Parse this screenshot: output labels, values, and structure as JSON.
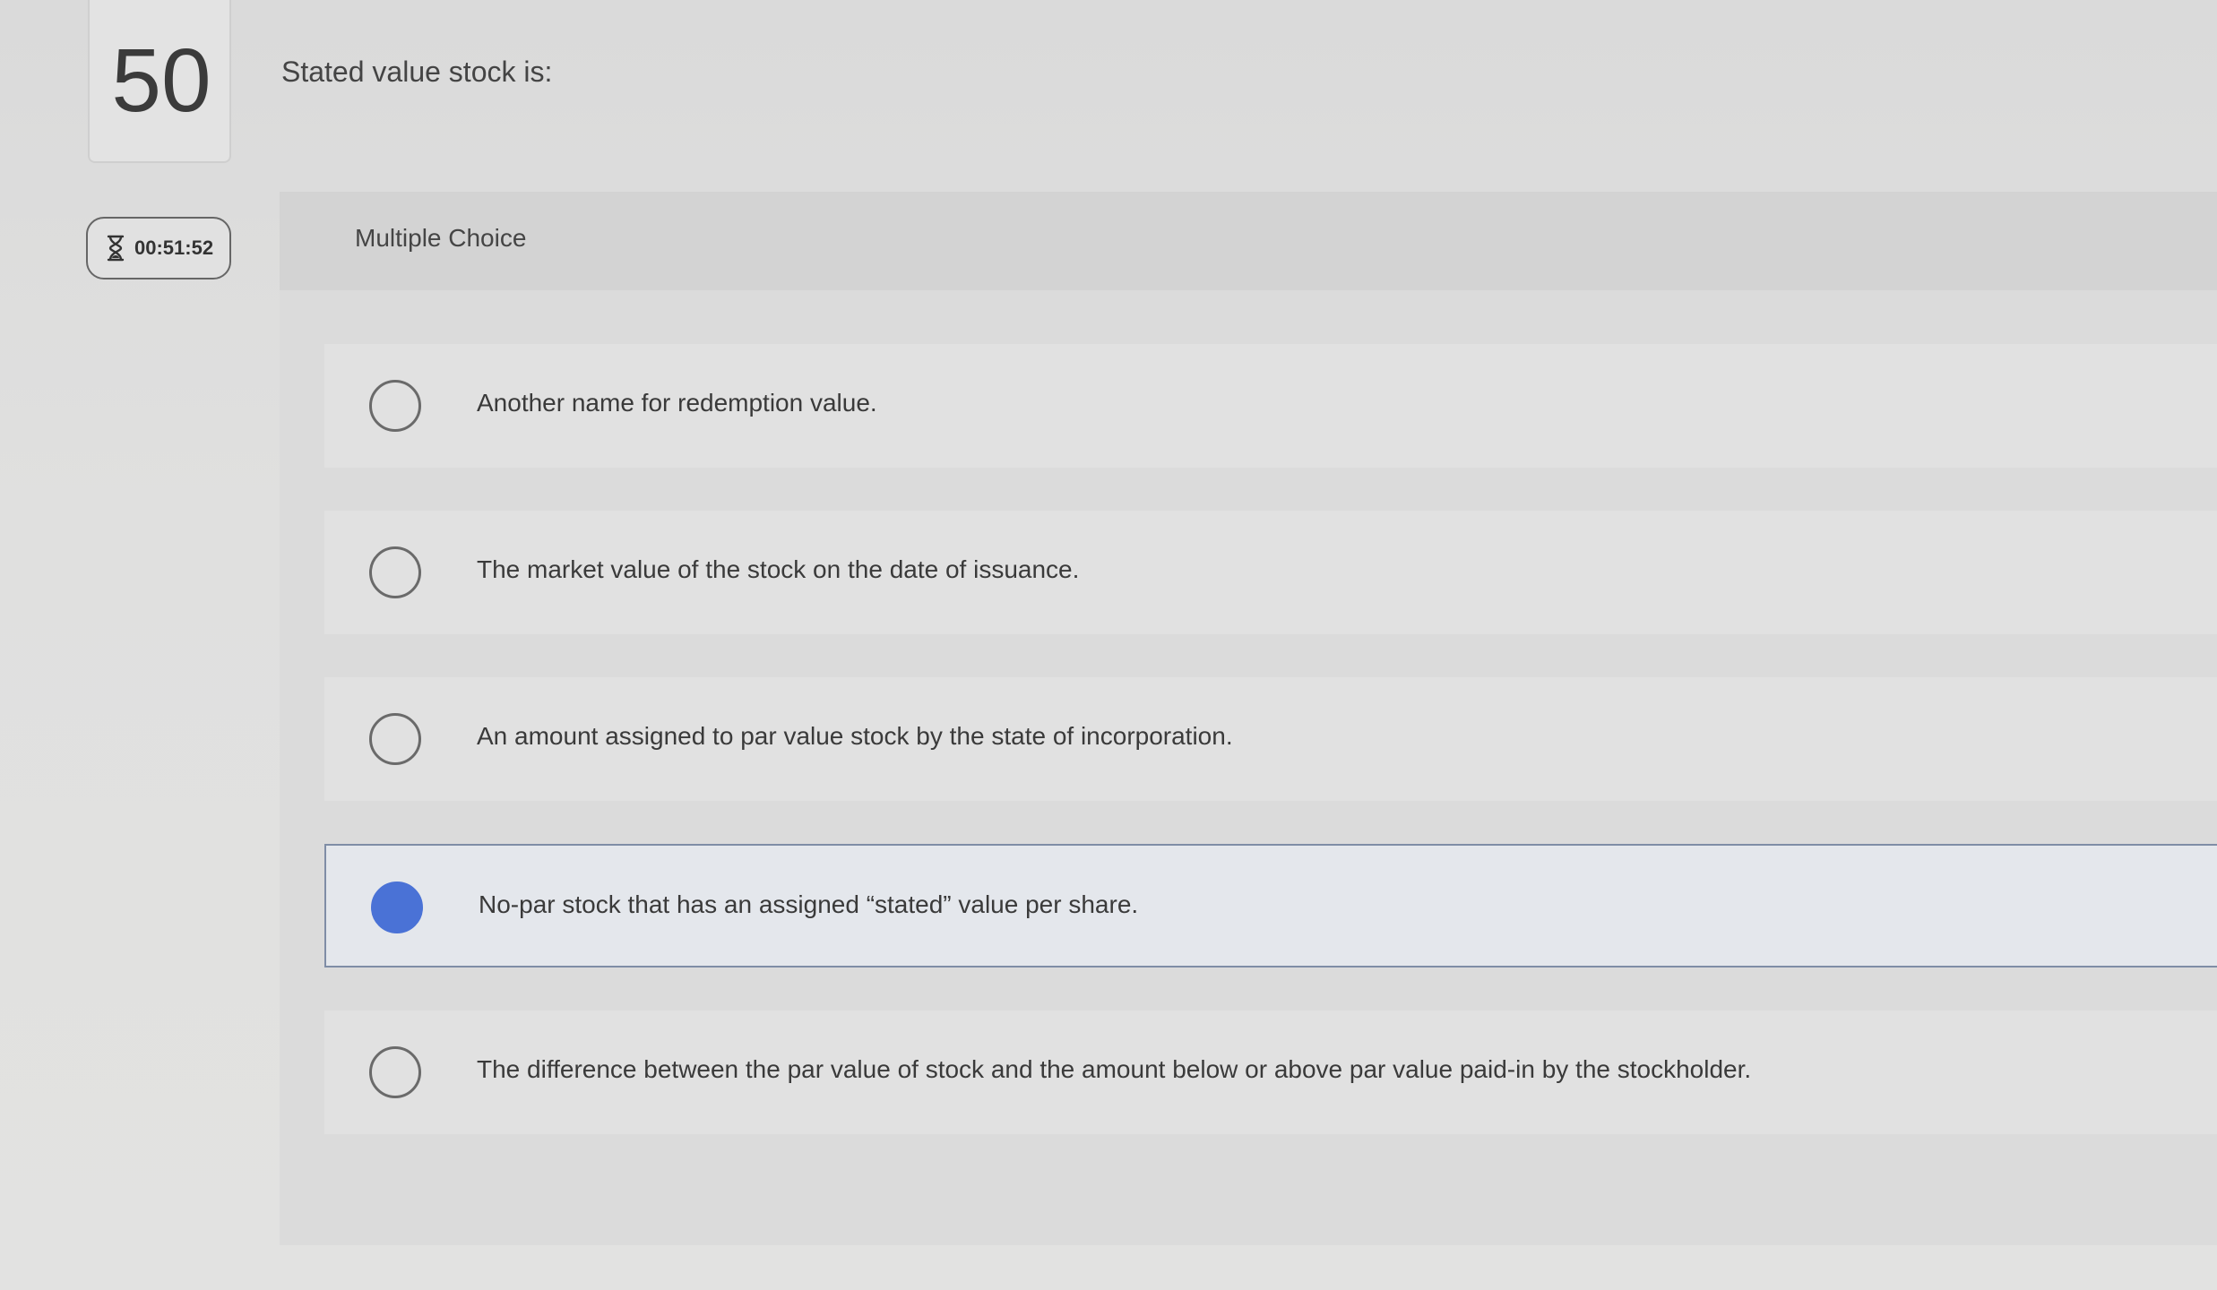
{
  "question": {
    "number": "50",
    "prompt": "Stated value stock is:"
  },
  "timer": {
    "icon": "hourglass-icon",
    "value": "00:51:52"
  },
  "panel": {
    "title": "Multiple Choice"
  },
  "options": [
    {
      "label": "Another name for redemption value.",
      "selected": false
    },
    {
      "label": "The market value of the stock on the date of issuance.",
      "selected": false
    },
    {
      "label": "An amount assigned to par value stock by the state of incorporation.",
      "selected": false
    },
    {
      "label": "No-par stock that has an assigned “stated” value per share.",
      "selected": true
    },
    {
      "label": "The difference between the par value of stock and the amount below or above par value paid-in by the stockholder.",
      "selected": false
    }
  ],
  "colors": {
    "selected_radio": "#4a72d6",
    "selected_border": "#7f8da6"
  }
}
